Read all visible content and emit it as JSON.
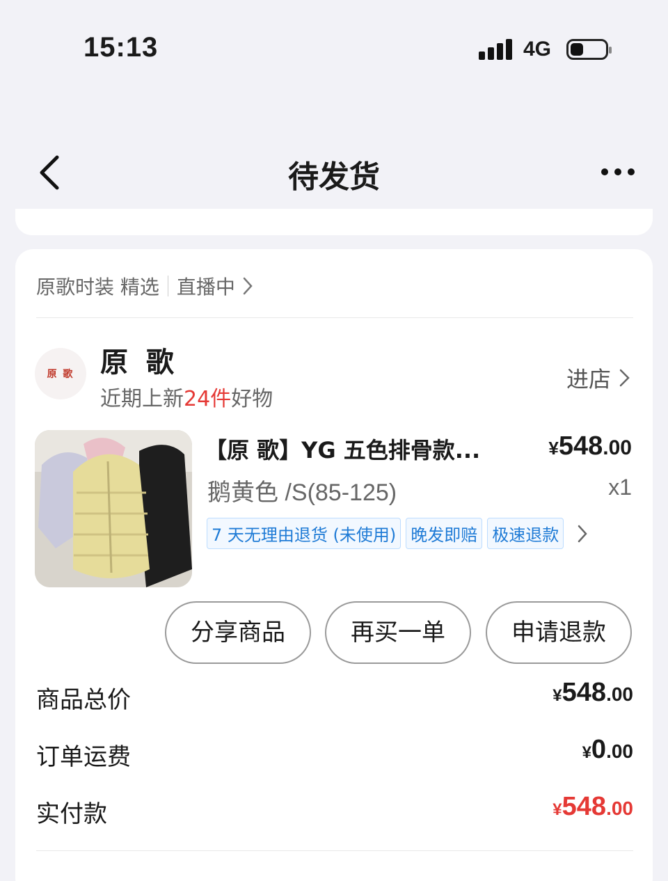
{
  "status_bar": {
    "time": "15:13",
    "network": "4G"
  },
  "nav": {
    "title": "待发货"
  },
  "live": {
    "name": "原歌时装 精选",
    "status": "直播中"
  },
  "shop": {
    "logo_text": "原 歌",
    "name": "原 歌",
    "desc_prefix": "近期上新",
    "desc_count": "24",
    "desc_unit": "件",
    "desc_suffix": "好物",
    "enter_label": "进店"
  },
  "product": {
    "title": "【原 歌】YG 五色排骨款...",
    "price_symbol": "¥",
    "price_int": "548",
    "price_dec": ".00",
    "spec": "鹅黄色 /S(85-125)",
    "qty": "x1",
    "tags": [
      "7 天无理由退货 (未使用)",
      "晚发即赔",
      "极速退款"
    ]
  },
  "actions": {
    "share": "分享商品",
    "rebuy": "再买一单",
    "refund": "申请退款"
  },
  "summary": {
    "goods_total_label": "商品总价",
    "goods_total_int": "548",
    "goods_total_dec": ".00",
    "shipping_label": "订单运费",
    "shipping_int": "0",
    "shipping_dec": ".00",
    "paid_label": "实付款",
    "paid_int": "548",
    "paid_dec": ".00",
    "currency": "¥"
  },
  "colors": {
    "accent_red": "#e53935",
    "tag_blue": "#1f7bd6"
  },
  "icons": {
    "back": "chevron-left-icon",
    "more": "more-dots-icon",
    "arrow": "chevron-right-icon"
  }
}
